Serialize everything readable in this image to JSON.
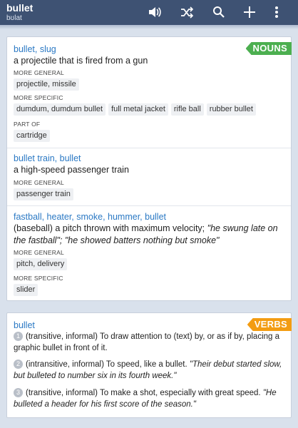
{
  "header": {
    "word": "bullet",
    "pronunciation": "bʊlat"
  },
  "toolbar": {
    "icons": [
      "speaker-icon",
      "shuffle-icon",
      "search-icon",
      "plus-icon",
      "more-vert-icon"
    ]
  },
  "colors": {
    "topbar": "#3e5273",
    "link": "#2b79c4",
    "nouns_tag": "#4caf50",
    "verbs_tag": "#f39c12"
  },
  "nouns": {
    "tag": "NOUNS",
    "senses": [
      {
        "headword": "bullet, slug",
        "gloss": "a projectile that is fired from a gun",
        "relations": [
          {
            "label": "MORE GENERAL",
            "chips": [
              "projectile, missile"
            ]
          },
          {
            "label": "MORE SPECIFIC",
            "chips": [
              "dumdum, dumdum bullet",
              "full metal jacket",
              "rifle ball",
              "rubber bullet"
            ]
          },
          {
            "label": "PART OF",
            "chips": [
              "cartridge"
            ]
          }
        ]
      },
      {
        "headword": "bullet train, bullet",
        "gloss": "a high-speed passenger train",
        "relations": [
          {
            "label": "MORE GENERAL",
            "chips": [
              "passenger train"
            ]
          }
        ]
      },
      {
        "headword": "fastball, heater, smoke, hummer, bullet",
        "gloss_plain": "(baseball) a pitch thrown with maximum velocity;",
        "gloss_example": "\"he swung late on the fastball\"; \"he showed batters nothing but smoke\"",
        "relations": [
          {
            "label": "MORE GENERAL",
            "chips": [
              "pitch, delivery"
            ]
          },
          {
            "label": "MORE SPECIFIC",
            "chips": [
              "slider"
            ]
          }
        ]
      }
    ]
  },
  "verbs": {
    "tag": "VERBS",
    "headword": "bullet",
    "items": [
      {
        "n": "1",
        "text": "(transitive, informal) To draw attention to (text) by, or as if by, placing a graphic bullet in front of it.",
        "example": ""
      },
      {
        "n": "2",
        "text": "(intransitive, informal) To speed, like a bullet.",
        "example": "\"Their debut started slow, but bulleted to number six in its fourth week.\""
      },
      {
        "n": "3",
        "text": "(transitive, informal) To make a shot, especially with great speed.",
        "example": "\"He bulleted a header for his first score of the season.\""
      }
    ]
  }
}
